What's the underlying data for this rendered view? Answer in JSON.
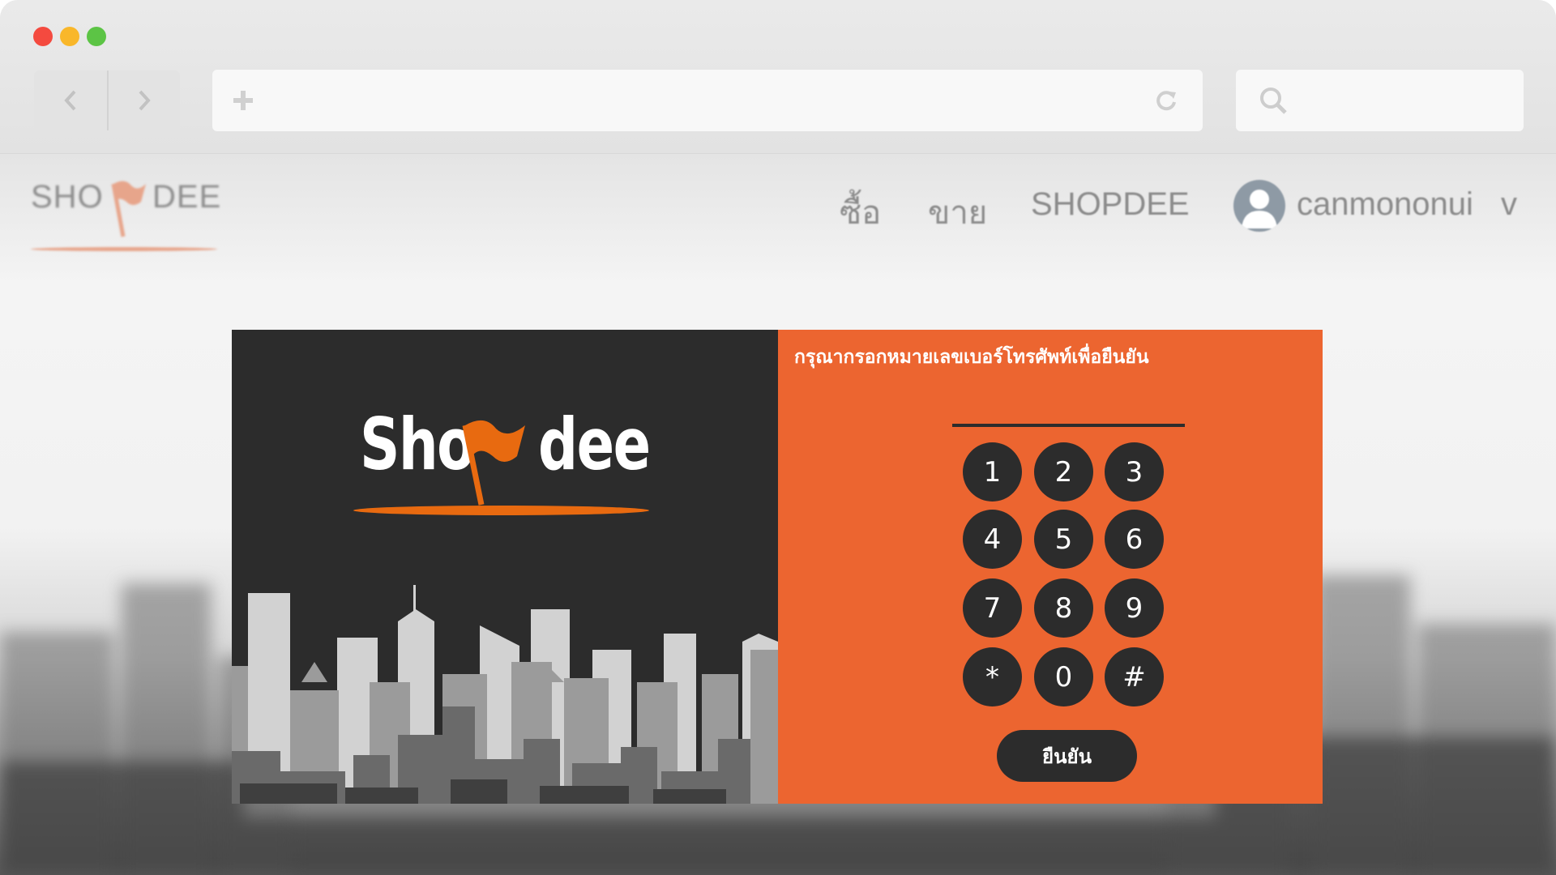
{
  "site": {
    "logo": {
      "left": "SHO",
      "right": "DEE"
    },
    "nav": [
      "ซื้อ",
      "ขาย",
      "SHOPDEE"
    ],
    "username": "canmononui",
    "user_caret": "v"
  },
  "modal": {
    "brand": {
      "left": "Sho",
      "right": "dee"
    },
    "prompt": "กรุณากรอกหมายเลขเบอร์โทรศัพท์เพื่อยืนยัน",
    "phone_value": "",
    "keys": [
      "1",
      "2",
      "3",
      "4",
      "5",
      "6",
      "7",
      "8",
      "9",
      "*",
      "0",
      "#"
    ],
    "confirm_label": "ยืนยัน"
  },
  "colors": {
    "accent": "#ec6530",
    "dark": "#2c2c2c",
    "flag": "#e86a10"
  },
  "icons": {
    "back": "chevron-left-icon",
    "forward": "chevron-right-icon",
    "new_tab": "plus-icon",
    "reload": "reload-icon",
    "search": "search-icon",
    "avatar": "user-avatar-icon"
  }
}
